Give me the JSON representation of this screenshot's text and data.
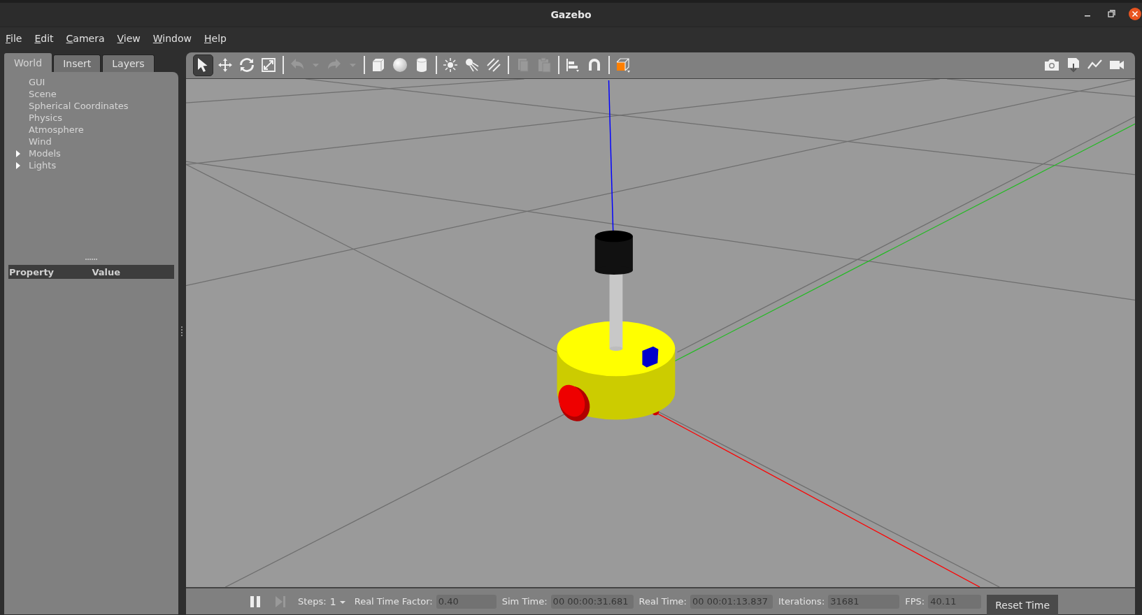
{
  "window": {
    "title": "Gazebo"
  },
  "menu": [
    {
      "label": "File"
    },
    {
      "label": "Edit"
    },
    {
      "label": "Camera"
    },
    {
      "label": "View"
    },
    {
      "label": "Window"
    },
    {
      "label": "Help"
    }
  ],
  "left_panel": {
    "tabs": [
      {
        "label": "World",
        "selected": true
      },
      {
        "label": "Insert",
        "selected": false
      },
      {
        "label": "Layers",
        "selected": false
      }
    ],
    "tree": [
      {
        "label": "GUI"
      },
      {
        "label": "Scene"
      },
      {
        "label": "Spherical Coordinates"
      },
      {
        "label": "Physics"
      },
      {
        "label": "Atmosphere"
      },
      {
        "label": "Wind"
      },
      {
        "label": "Models",
        "expanded": false
      },
      {
        "label": "Lights",
        "expanded": false
      }
    ],
    "property_table": {
      "columns": [
        "Property",
        "Value"
      ]
    }
  },
  "toolbar": {
    "tools": [
      {
        "kind": "select",
        "selected": true,
        "disabled": false
      },
      {
        "kind": "translate",
        "selected": false,
        "disabled": false
      },
      {
        "kind": "rotate",
        "selected": false,
        "disabled": false
      },
      {
        "kind": "scale",
        "selected": false,
        "disabled": false
      },
      {
        "kind": "separator"
      },
      {
        "kind": "undo",
        "selected": false,
        "disabled": true
      },
      {
        "kind": "caret",
        "selected": false,
        "disabled": true
      },
      {
        "kind": "redo",
        "selected": false,
        "disabled": true
      },
      {
        "kind": "caret",
        "selected": false,
        "disabled": true
      },
      {
        "kind": "separator"
      },
      {
        "kind": "box",
        "selected": false,
        "disabled": false
      },
      {
        "kind": "sphere",
        "selected": false,
        "disabled": false
      },
      {
        "kind": "cylinder",
        "selected": false,
        "disabled": false
      },
      {
        "kind": "separator"
      },
      {
        "kind": "pointlight",
        "selected": false,
        "disabled": false
      },
      {
        "kind": "spotlight",
        "selected": false,
        "disabled": false
      },
      {
        "kind": "dirlight",
        "selected": false,
        "disabled": false
      },
      {
        "kind": "separator"
      },
      {
        "kind": "copy",
        "selected": false,
        "disabled": true
      },
      {
        "kind": "paste",
        "selected": false,
        "disabled": true
      },
      {
        "kind": "separator"
      },
      {
        "kind": "align",
        "selected": false,
        "disabled": false
      },
      {
        "kind": "snap",
        "selected": false,
        "disabled": false
      },
      {
        "kind": "separator"
      },
      {
        "kind": "view",
        "selected": false,
        "disabled": false
      }
    ],
    "right_tools": [
      {
        "kind": "camera"
      },
      {
        "kind": "log"
      },
      {
        "kind": "plot"
      },
      {
        "kind": "video"
      }
    ]
  },
  "status_bar": {
    "steps": {
      "label": "Steps:",
      "value": "1"
    },
    "fields": [
      {
        "label": "Real Time Factor:",
        "value": "0.40"
      },
      {
        "label": "Sim Time:",
        "value": "00 00:00:31.681"
      },
      {
        "label": "Real Time:",
        "value": "00 00:01:13.837"
      },
      {
        "label": "Iterations:",
        "value": "31681"
      },
      {
        "label": "FPS:",
        "value": "40.11"
      }
    ],
    "reset_button": "Reset Time"
  }
}
